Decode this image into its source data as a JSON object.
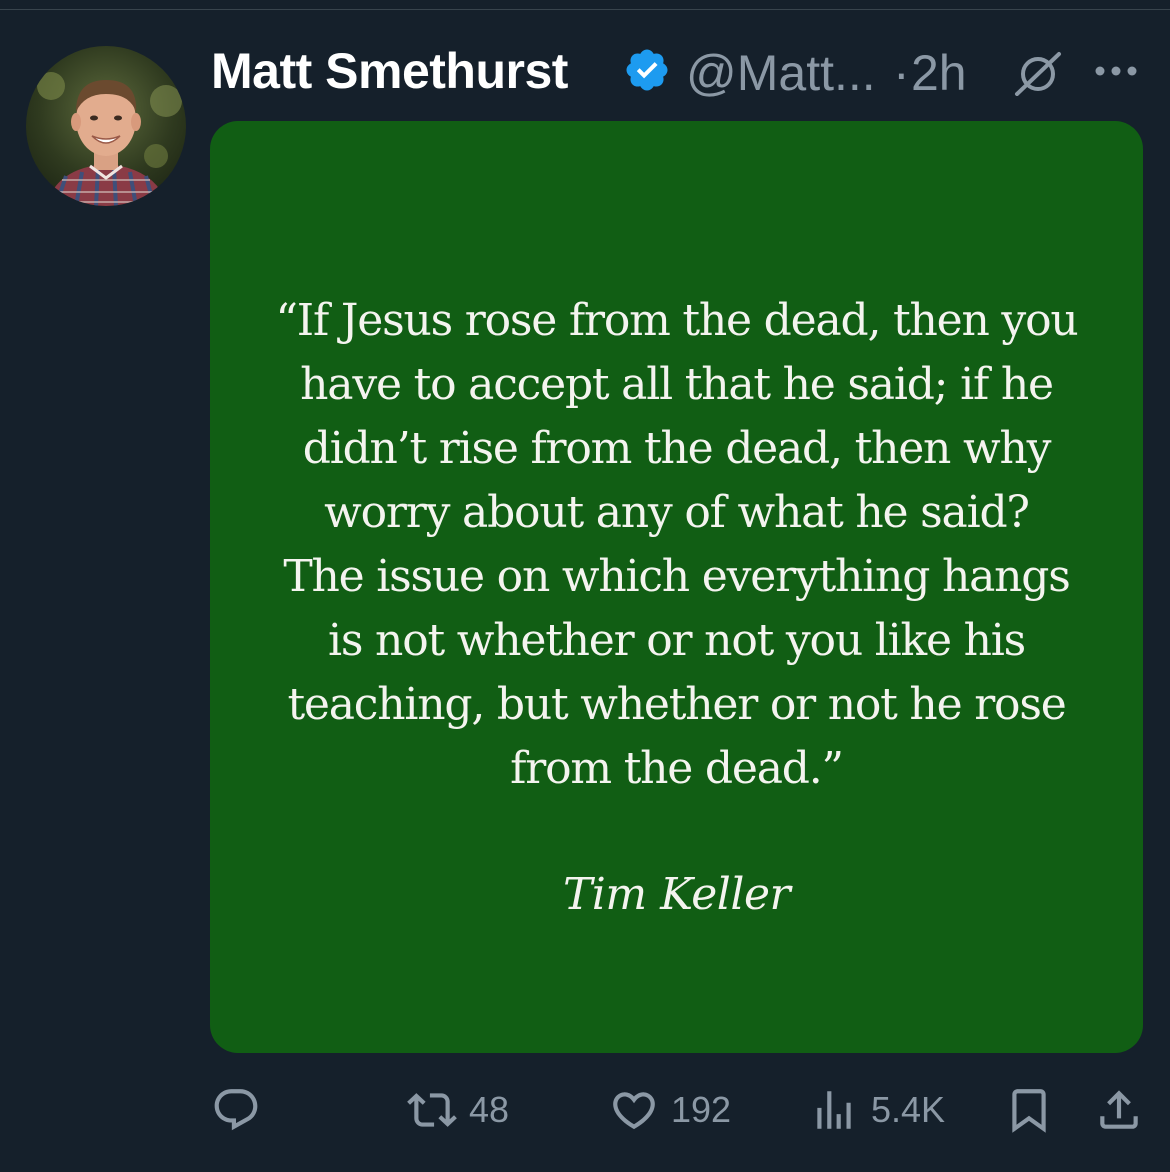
{
  "tweet": {
    "author": {
      "display_name": "Matt Smethurst",
      "handle": "@Matt...",
      "verified": true,
      "verified_icon": "verified-badge-icon",
      "avatar_icon": "profile-photo-avatar"
    },
    "separator": "·",
    "time": "2h",
    "header_icons": [
      "grok-icon",
      "more-options-icon"
    ],
    "media": {
      "background_color": "#115e14",
      "quote_lines": [
        "“If Jesus rose from the dead, then you",
        "have to accept all that he said; if he",
        "didn’t rise from the dead, then why",
        "worry about any of what he said?",
        "The issue on which everything hangs",
        "is not whether or not you like his",
        "teaching, but whether or not he rose",
        "from the dead.”"
      ],
      "attribution": "Tim Keller"
    },
    "actions": {
      "reply": {
        "icon": "reply-icon",
        "count": ""
      },
      "retweet": {
        "icon": "retweet-icon",
        "count": "48"
      },
      "like": {
        "icon": "heart-icon",
        "count": "192"
      },
      "views": {
        "icon": "views-chart-icon",
        "count": "5.4K"
      },
      "bookmark": {
        "icon": "bookmark-icon"
      },
      "share": {
        "icon": "share-icon"
      }
    }
  },
  "colors": {
    "background": "#15202b",
    "text_primary": "#ffffff",
    "text_secondary": "#8b98a5",
    "verified_blue": "#1d9bf0",
    "media_green": "#115e14"
  }
}
